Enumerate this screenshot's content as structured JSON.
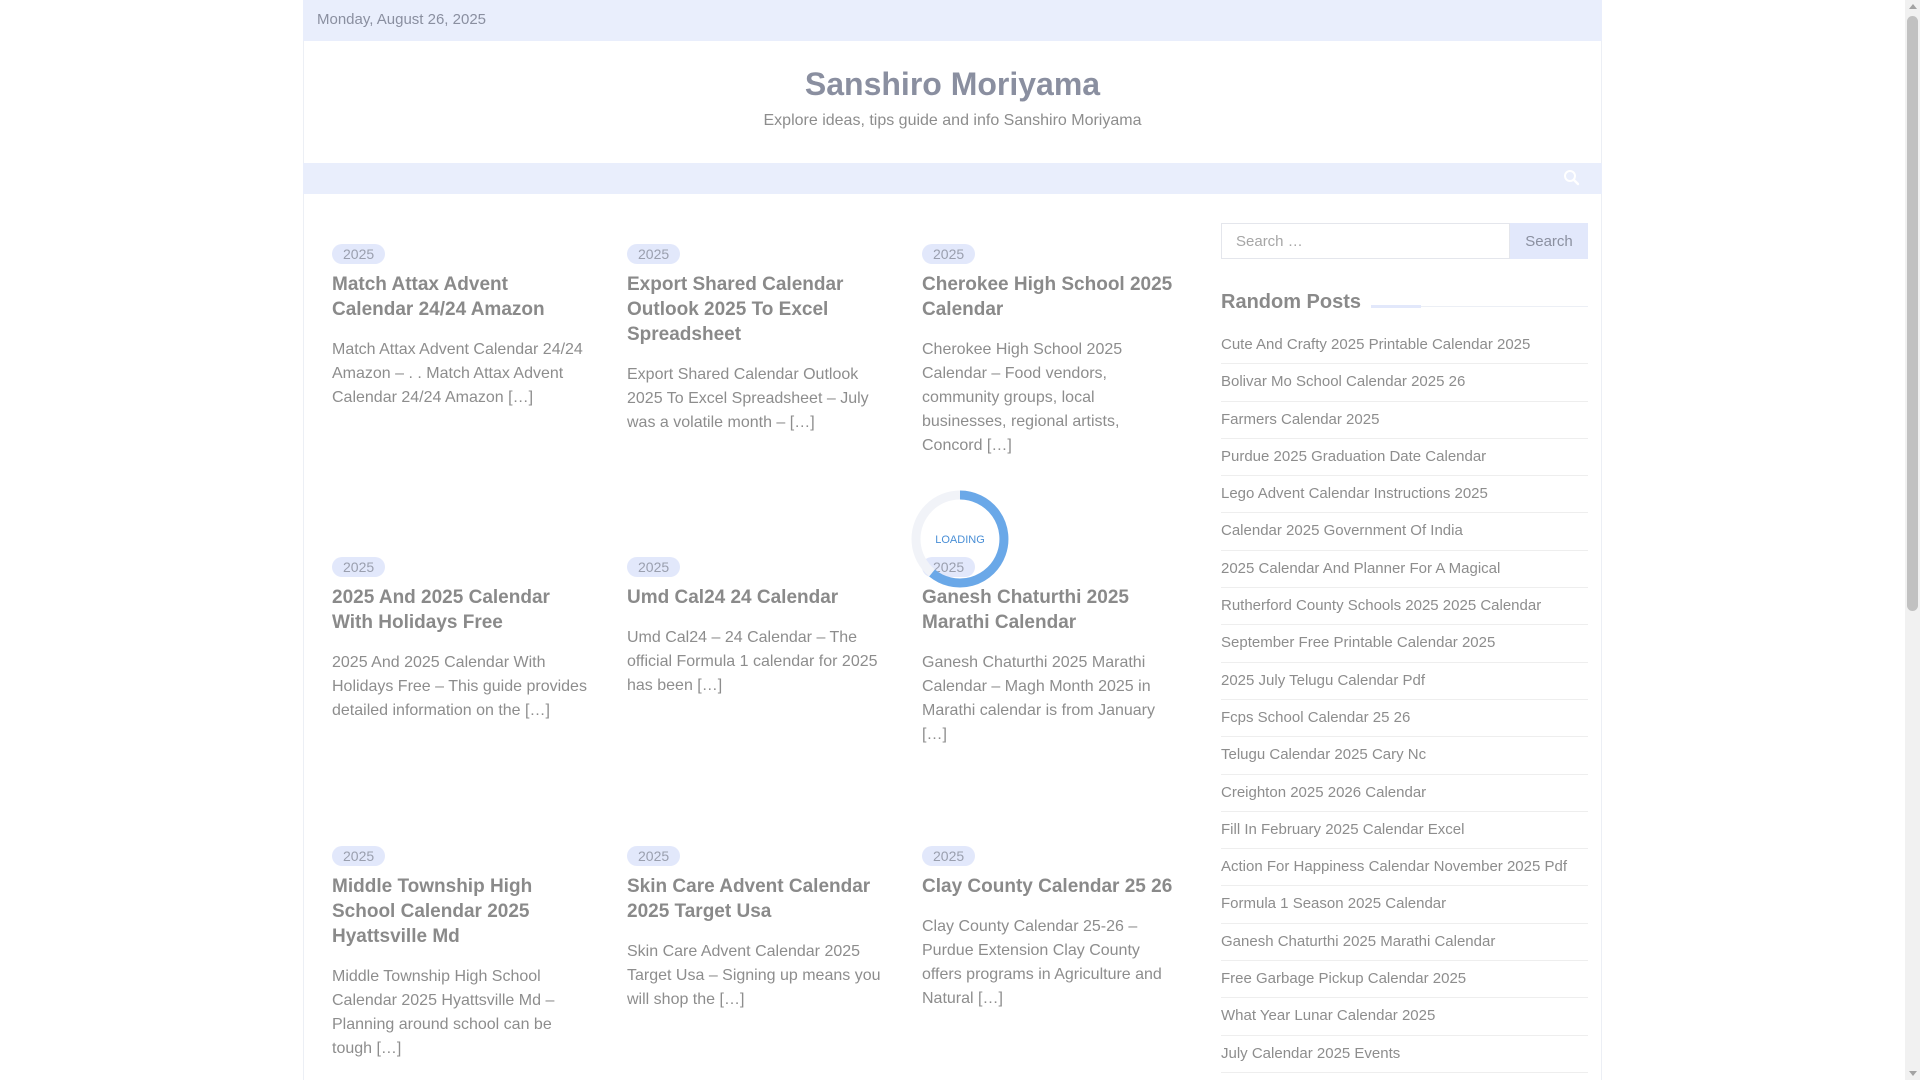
{
  "topbar": {
    "date": "Monday, August 26, 2025"
  },
  "header": {
    "site_title": "Sanshiro Moriyama",
    "tagline": "Explore ideas, tips guide and info Sanshiro Moriyama"
  },
  "loader": {
    "text": "LOADING"
  },
  "posts": [
    {
      "category": "2025",
      "title": "Match Attax Advent Calendar 24/24 Amazon",
      "excerpt": "Match Attax Advent Calendar 24/24 Amazon – . . Match Attax Advent Calendar 24/24 Amazon […]"
    },
    {
      "category": "2025",
      "title": "Export Shared Calendar Outlook 2025 To Excel Spreadsheet",
      "excerpt": "Export Shared Calendar Outlook 2025 To Excel Spreadsheet – July was a volatile month – […]"
    },
    {
      "category": "2025",
      "title": "Cherokee High School 2025 Calendar",
      "excerpt": "Cherokee High School 2025 Calendar – Food vendors, community groups, local businesses, regional artists, Concord […]"
    },
    {
      "category": "2025",
      "title": "2025 And 2025 Calendar With Holidays Free",
      "excerpt": "2025 And 2025 Calendar With Holidays Free – This guide provides detailed information on the […]"
    },
    {
      "category": "2025",
      "title": "Umd Cal24 24 Calendar",
      "excerpt": "Umd Cal24 – 24 Calendar – The official Formula 1 calendar for 2025 has been […]"
    },
    {
      "category": "2025",
      "title": "Ganesh Chaturthi 2025 Marathi Calendar",
      "excerpt": "Ganesh Chaturthi 2025 Marathi Calendar – Magh Month 2025 in Marathi calendar is from January […]"
    },
    {
      "category": "2025",
      "title": "Middle Township High School Calendar 2025 Hyattsville Md",
      "excerpt": "Middle Township High School Calendar 2025 Hyattsville Md – Planning around school can be tough […]"
    },
    {
      "category": "2025",
      "title": "Skin Care Advent Calendar 2025 Target Usa",
      "excerpt": "Skin Care Advent Calendar 2025 Target Usa – Signing up means you will shop the […]"
    },
    {
      "category": "2025",
      "title": "Clay County Calendar 25 26",
      "excerpt": "Clay County Calendar 25-26 – Purdue Extension Clay County offers programs in Agriculture and Natural […]"
    }
  ],
  "sidebar": {
    "search_placeholder": "Search …",
    "search_button": "Search",
    "random_posts_title": "Random Posts",
    "random_posts": [
      "Cute And Crafty 2025 Printable Calendar 2025",
      "Bolivar Mo School Calendar 2025 26",
      "Farmers Calendar 2025",
      "Purdue 2025 Graduation Date Calendar",
      "Lego Advent Calendar Instructions 2025",
      "Calendar 2025 Government Of India",
      "2025 Calendar And Planner For A Magical",
      "Rutherford County Schools 2025 2025 Calendar",
      "September Free Printable Calendar 2025",
      "2025 July Telugu Calendar Pdf",
      "Fcps School Calendar 25 26",
      "Telugu Calendar 2025 Cary Nc",
      "Creighton 2025 2026 Calendar",
      "Fill In February 2025 Calendar Excel",
      "Action For Happiness Calendar November 2025 Pdf",
      "Formula 1 Season 2025 Calendar",
      "Ganesh Chaturthi 2025 Marathi Calendar",
      "Free Garbage Pickup Calendar 2025",
      "What Year Lunar Calendar 2025",
      "July Calendar 2025 Events"
    ]
  },
  "colors": {
    "accent_bg": "#e9eefc",
    "badge_bg": "#e2e8fb",
    "loader_blue": "#6aa8e8"
  },
  "icons": {
    "search_toggle": "search-icon"
  }
}
